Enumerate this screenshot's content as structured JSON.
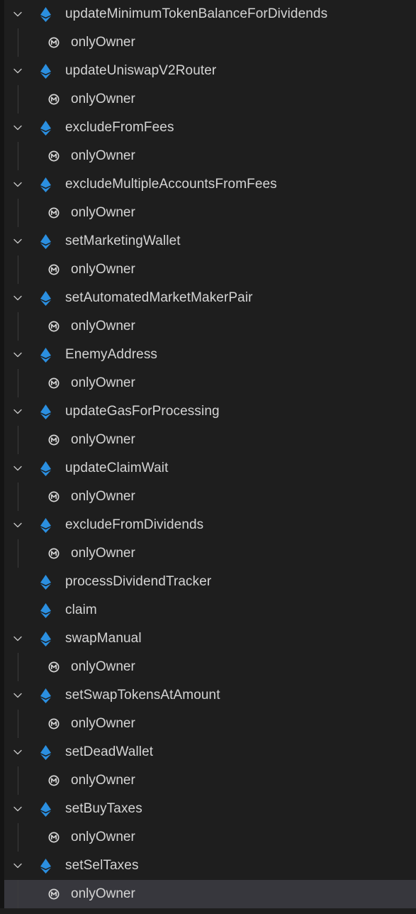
{
  "accent_color": "#2b8fe0",
  "icons": {
    "expand": "chevron-down-icon",
    "function": "ethereum-diamond-icon",
    "modifier": "modifier-m-icon"
  },
  "outline": {
    "rows": [
      {
        "kind": "function",
        "label": "updateMinimumTokenBalanceForDividends",
        "expanded": true
      },
      {
        "kind": "modifier",
        "label": "onlyOwner"
      },
      {
        "kind": "function",
        "label": "updateUniswapV2Router",
        "expanded": true
      },
      {
        "kind": "modifier",
        "label": "onlyOwner"
      },
      {
        "kind": "function",
        "label": "excludeFromFees",
        "expanded": true
      },
      {
        "kind": "modifier",
        "label": "onlyOwner"
      },
      {
        "kind": "function",
        "label": "excludeMultipleAccountsFromFees",
        "expanded": true
      },
      {
        "kind": "modifier",
        "label": "onlyOwner"
      },
      {
        "kind": "function",
        "label": "setMarketingWallet",
        "expanded": true
      },
      {
        "kind": "modifier",
        "label": "onlyOwner"
      },
      {
        "kind": "function",
        "label": "setAutomatedMarketMakerPair",
        "expanded": true
      },
      {
        "kind": "modifier",
        "label": "onlyOwner"
      },
      {
        "kind": "function",
        "label": "EnemyAddress",
        "expanded": true
      },
      {
        "kind": "modifier",
        "label": "onlyOwner"
      },
      {
        "kind": "function",
        "label": "updateGasForProcessing",
        "expanded": true
      },
      {
        "kind": "modifier",
        "label": "onlyOwner"
      },
      {
        "kind": "function",
        "label": "updateClaimWait",
        "expanded": true
      },
      {
        "kind": "modifier",
        "label": "onlyOwner"
      },
      {
        "kind": "function",
        "label": "excludeFromDividends",
        "expanded": true
      },
      {
        "kind": "modifier",
        "label": "onlyOwner"
      },
      {
        "kind": "function",
        "label": "processDividendTracker",
        "expanded": false
      },
      {
        "kind": "function",
        "label": "claim",
        "expanded": false
      },
      {
        "kind": "function",
        "label": "swapManual",
        "expanded": true
      },
      {
        "kind": "modifier",
        "label": "onlyOwner"
      },
      {
        "kind": "function",
        "label": "setSwapTokensAtAmount",
        "expanded": true
      },
      {
        "kind": "modifier",
        "label": "onlyOwner"
      },
      {
        "kind": "function",
        "label": "setDeadWallet",
        "expanded": true
      },
      {
        "kind": "modifier",
        "label": "onlyOwner"
      },
      {
        "kind": "function",
        "label": "setBuyTaxes",
        "expanded": true
      },
      {
        "kind": "modifier",
        "label": "onlyOwner"
      },
      {
        "kind": "function",
        "label": "setSelTaxes",
        "expanded": true
      },
      {
        "kind": "modifier",
        "label": "onlyOwner",
        "selected": true
      }
    ]
  }
}
